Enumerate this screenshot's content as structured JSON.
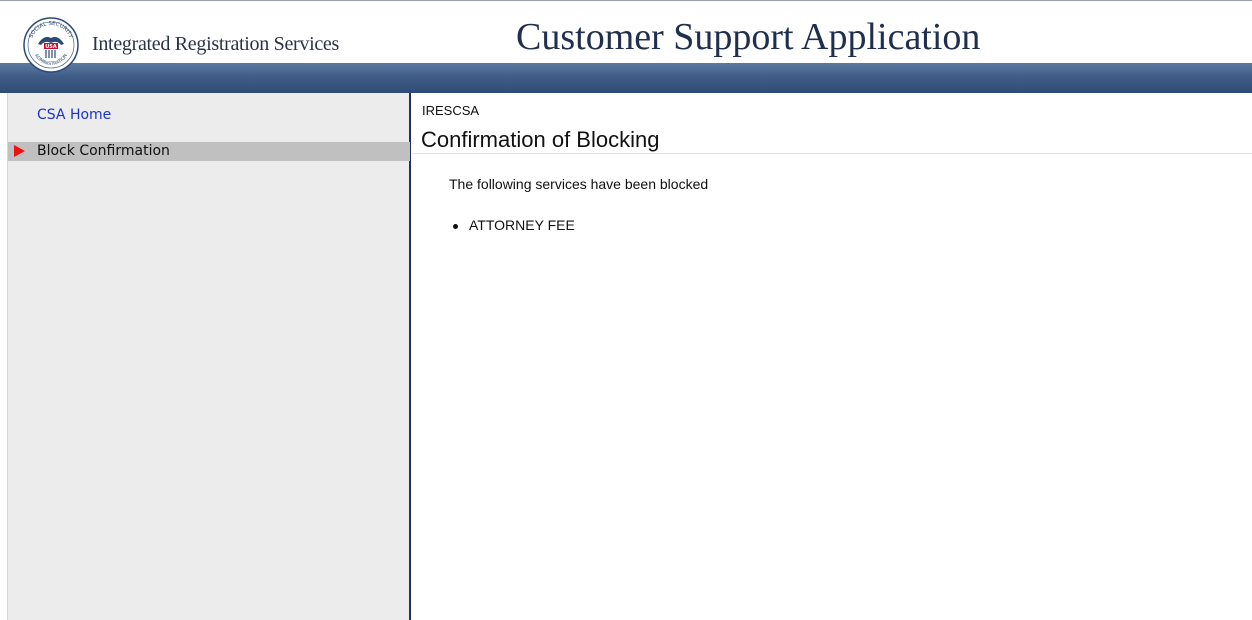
{
  "header": {
    "org_name": "Integrated Registration Services",
    "app_title": "Customer Support Application",
    "seal_icon": "ssa-seal-icon",
    "seal_text_top": "SOCIAL SECURITY",
    "seal_text_bottom": "ADMINISTRATION",
    "seal_text_center": "USA"
  },
  "sidebar": {
    "home_link": "CSA Home",
    "active_item": "Block Confirmation",
    "active_indicator_icon": "red-arrow-icon"
  },
  "main": {
    "app_code": "IRESCSA",
    "page_title": "Confirmation of Blocking",
    "message": "The following services have been blocked",
    "blocked_services": [
      "ATTORNEY FEE"
    ]
  },
  "colors": {
    "band": "#3f5d86",
    "link": "#1a33cc",
    "active_bg": "#c0c0c0",
    "arrow": "#ee1111",
    "divider": "#1c2f6b"
  }
}
